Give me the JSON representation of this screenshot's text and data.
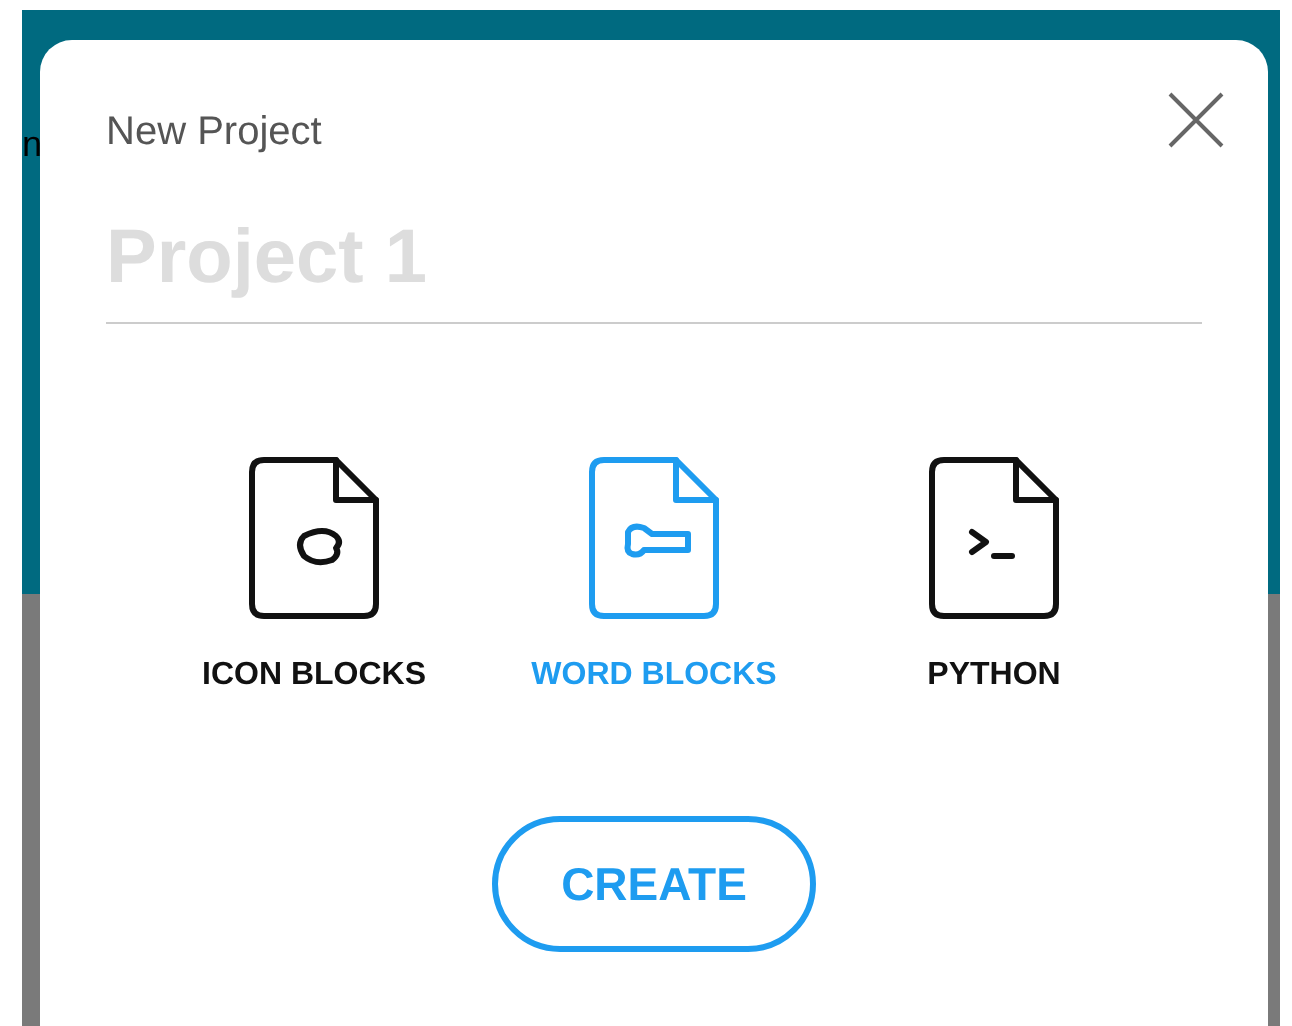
{
  "background": {
    "edge_text": "n"
  },
  "dialog": {
    "title": "New Project",
    "name_field": {
      "placeholder": "Project 1"
    },
    "options": [
      {
        "kind": "icon",
        "label": "ICON BLOCKS",
        "selected": false
      },
      {
        "kind": "word",
        "label": "WORD BLOCKS",
        "selected": true
      },
      {
        "kind": "python",
        "label": "PYTHON",
        "selected": false
      }
    ],
    "create_button": "CREATE"
  }
}
